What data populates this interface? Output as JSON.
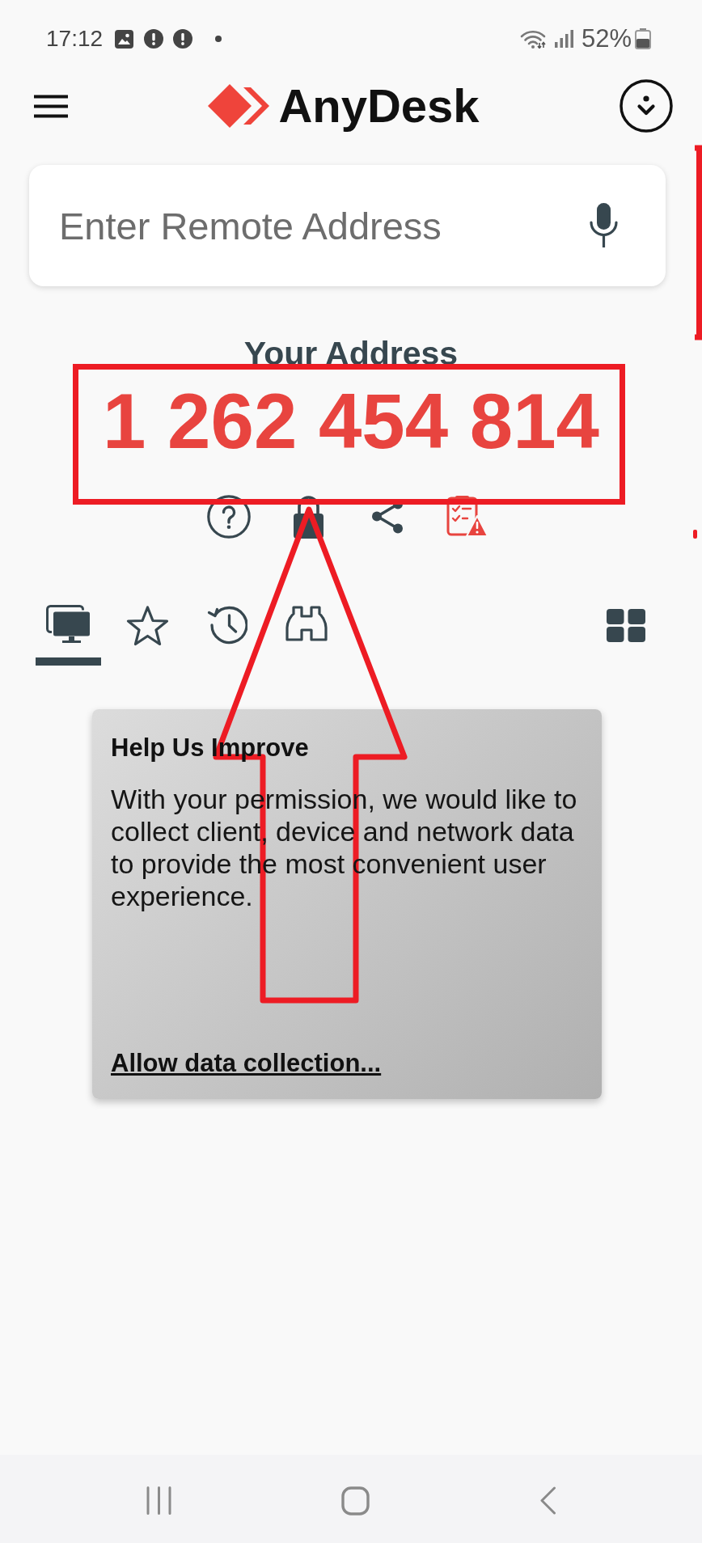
{
  "status_bar": {
    "time": "17:12",
    "battery_percent": "52%"
  },
  "header": {
    "title": "AnyDesk"
  },
  "search": {
    "placeholder": "Enter Remote Address"
  },
  "address": {
    "label": "Your Address",
    "value": "1 262 454 814"
  },
  "tabs": [
    {
      "selected": true
    },
    {
      "selected": false
    },
    {
      "selected": false
    },
    {
      "selected": false
    }
  ],
  "card": {
    "title": "Help Us Improve",
    "text": "With your permission, we would like to collect client, device and network data to provide the most convenient user experience.",
    "link": "Allow data collection..."
  },
  "annotations": [
    {
      "kind": "rectangle"
    },
    {
      "kind": "arrow"
    },
    {
      "kind": "bracket"
    },
    {
      "kind": "mark"
    }
  ]
}
